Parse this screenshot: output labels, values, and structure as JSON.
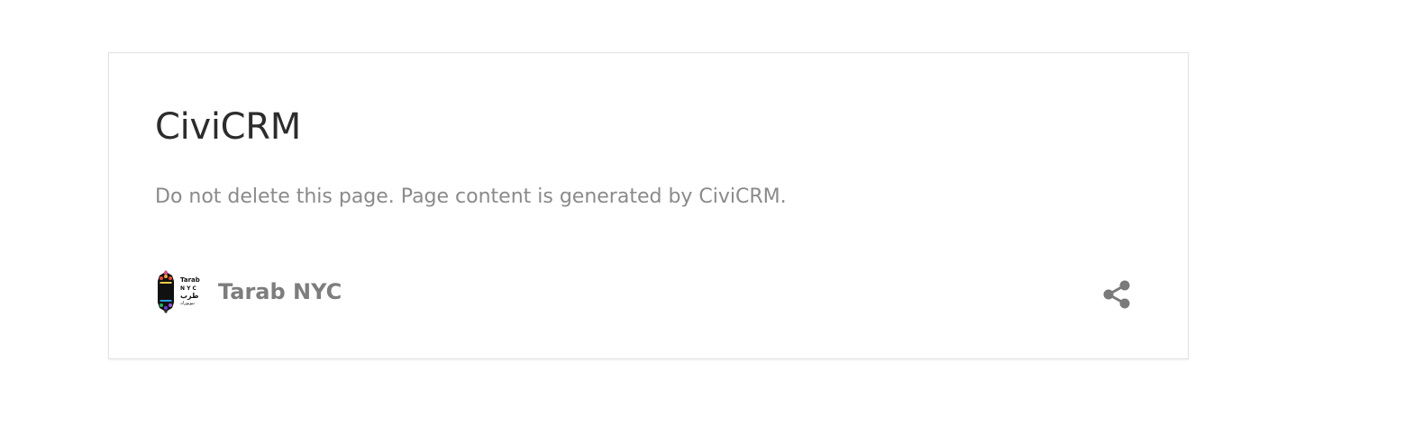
{
  "page": {
    "title": "CiviCRM",
    "body": "Do not delete this page. Page content is generated by CiviCRM."
  },
  "footer": {
    "site_name": "Tarab NYC",
    "logo": {
      "icon": "tarab-nyc-logo",
      "lines": [
        "Tarab",
        "N Y C",
        "طرب",
        "نيويورك"
      ]
    },
    "share_icon": "share-icon"
  },
  "colors": {
    "title": "#2c2c2c",
    "body_text": "#8a8a8a",
    "site_name": "#7d7d7d",
    "share_icon": "#7a7a7a",
    "card_border": "#e2e2e2"
  }
}
